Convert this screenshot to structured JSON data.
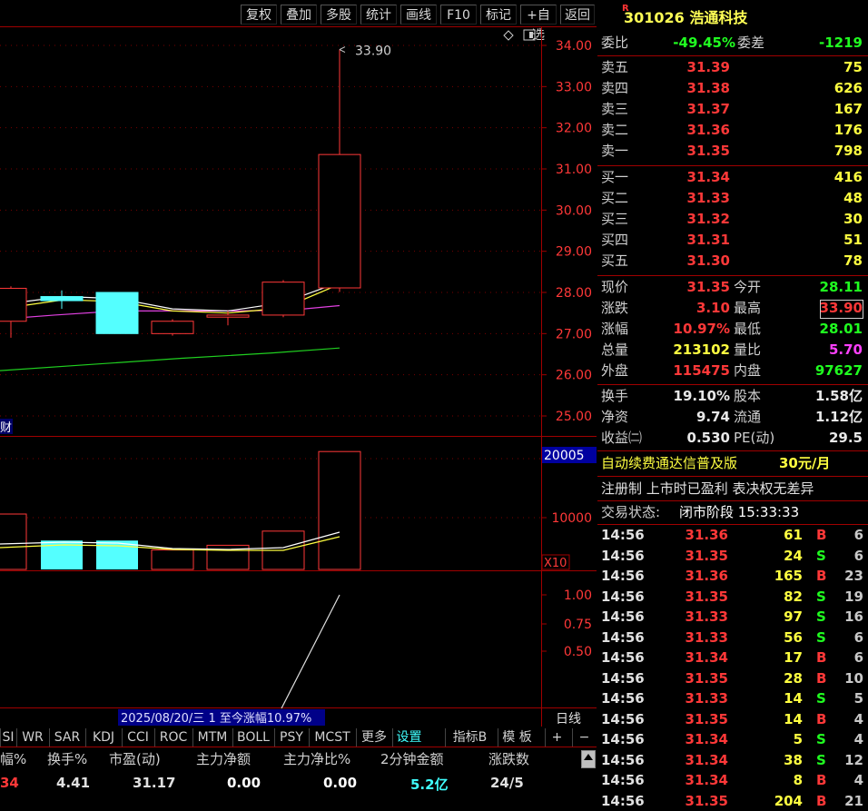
{
  "toolbar": {
    "buttons": [
      "复权",
      "叠加",
      "多股",
      "统计",
      "画线",
      "F10",
      "标记",
      "+自选",
      "返回"
    ]
  },
  "stock": {
    "badge": "R",
    "code": "301026",
    "name": "浩通科技"
  },
  "chart": {
    "price_axis": [
      "34.00",
      "33.00",
      "32.00",
      "31.00",
      "30.00",
      "29.00",
      "28.00",
      "27.00",
      "26.00",
      "25.00"
    ],
    "high_label": "33.90",
    "fin_label": "财",
    "vol_axis": [
      "20005",
      "10000"
    ],
    "vol_badge": "20005",
    "vol_x10": "X10",
    "ind_axis": [
      "1.00",
      "0.75",
      "0.50"
    ],
    "range_text": "2025/08/20/三 1 至今涨幅10.97%",
    "period": "日线"
  },
  "chart_data": {
    "type": "candlestick",
    "title": "",
    "ylim": [
      24.5,
      34.3
    ],
    "candles": [
      {
        "open": 27.3,
        "close": 28.1,
        "high": 28.15,
        "low": 26.9,
        "color": "red"
      },
      {
        "open": 27.9,
        "close": 27.8,
        "high": 28.05,
        "low": 27.6,
        "color": "cyan"
      },
      {
        "open": 28.0,
        "close": 27.0,
        "high": 28.0,
        "low": 27.0,
        "color": "cyan"
      },
      {
        "open": 27.0,
        "close": 27.3,
        "high": 27.35,
        "low": 26.95,
        "color": "red"
      },
      {
        "open": 27.4,
        "close": 27.45,
        "high": 27.55,
        "low": 27.2,
        "color": "red"
      },
      {
        "open": 27.45,
        "close": 28.25,
        "high": 28.3,
        "low": 27.4,
        "color": "red"
      },
      {
        "open": 28.11,
        "close": 31.35,
        "high": 33.9,
        "low": 28.01,
        "color": "red"
      }
    ],
    "volumes": [
      {
        "value": 9400,
        "color": "red"
      },
      {
        "value": 4900,
        "color": "cyan"
      },
      {
        "value": 4900,
        "color": "cyan"
      },
      {
        "value": 3300,
        "color": "red"
      },
      {
        "value": 4100,
        "color": "red"
      },
      {
        "value": 6500,
        "color": "red"
      },
      {
        "value": 20005,
        "color": "red"
      }
    ],
    "vol_ylim": [
      0,
      22500
    ],
    "ind_ylim": [
      0.25,
      1.05
    ],
    "ind_line": [
      [
        310,
        0.0
      ],
      [
        372,
        1.0
      ]
    ]
  },
  "quote": {
    "weibi_label": "委比",
    "weibi": "-49.45%",
    "weicha_label": "委差",
    "weicha": "-1219",
    "asks": [
      {
        "label": "卖五",
        "price": "31.39",
        "vol": "75"
      },
      {
        "label": "卖四",
        "price": "31.38",
        "vol": "626"
      },
      {
        "label": "卖三",
        "price": "31.37",
        "vol": "167"
      },
      {
        "label": "卖二",
        "price": "31.36",
        "vol": "176"
      },
      {
        "label": "卖一",
        "price": "31.35",
        "vol": "798"
      }
    ],
    "bids": [
      {
        "label": "买一",
        "price": "31.34",
        "vol": "416"
      },
      {
        "label": "买二",
        "price": "31.33",
        "vol": "48"
      },
      {
        "label": "买三",
        "price": "31.32",
        "vol": "30"
      },
      {
        "label": "买四",
        "price": "31.31",
        "vol": "51"
      },
      {
        "label": "买五",
        "price": "31.30",
        "vol": "78"
      }
    ],
    "stats": [
      {
        "l1": "现价",
        "v1": "31.35",
        "c1": "red",
        "l2": "今开",
        "v2": "28.11",
        "c2": "grn"
      },
      {
        "l1": "涨跌",
        "v1": "3.10",
        "c1": "red",
        "l2": "最高",
        "v2": "33.90",
        "c2": "red"
      },
      {
        "l1": "涨幅",
        "v1": "10.97%",
        "c1": "red",
        "l2": "最低",
        "v2": "28.01",
        "c2": "grn"
      },
      {
        "l1": "总量",
        "v1": "213102",
        "c1": "yel",
        "l2": "量比",
        "v2": "5.70",
        "c2": "mag"
      },
      {
        "l1": "外盘",
        "v1": "115475",
        "c1": "red",
        "l2": "内盘",
        "v2": "97627",
        "c2": "grn"
      }
    ],
    "fund": [
      {
        "l1": "换手",
        "v1": "19.10%",
        "l2": "股本",
        "v2": "1.58亿"
      },
      {
        "l1": "净资",
        "v1": "9.74",
        "l2": "流通",
        "v2": "1.12亿"
      },
      {
        "l1": "收益㈡",
        "v1": "0.530",
        "l2": "PE(动)",
        "v2": "29.5"
      }
    ],
    "promo": "自动续费通达信普及版",
    "promo_price": "30元/月",
    "tags": "注册制 上市时已盈利 表决权无差异",
    "trade_state_label": "交易状态:",
    "trade_state": "闭市阶段 15:33:33"
  },
  "ticks": [
    {
      "t": "14:56",
      "p": "31.36",
      "v": "61",
      "d": "B",
      "n": "6"
    },
    {
      "t": "14:56",
      "p": "31.35",
      "v": "24",
      "d": "S",
      "n": "6"
    },
    {
      "t": "14:56",
      "p": "31.36",
      "v": "165",
      "d": "B",
      "n": "23"
    },
    {
      "t": "14:56",
      "p": "31.35",
      "v": "82",
      "d": "S",
      "n": "19"
    },
    {
      "t": "14:56",
      "p": "31.33",
      "v": "97",
      "d": "S",
      "n": "16"
    },
    {
      "t": "14:56",
      "p": "31.33",
      "v": "56",
      "d": "S",
      "n": "6"
    },
    {
      "t": "14:56",
      "p": "31.34",
      "v": "17",
      "d": "B",
      "n": "6"
    },
    {
      "t": "14:56",
      "p": "31.35",
      "v": "28",
      "d": "B",
      "n": "10"
    },
    {
      "t": "14:56",
      "p": "31.33",
      "v": "14",
      "d": "S",
      "n": "5"
    },
    {
      "t": "14:56",
      "p": "31.35",
      "v": "14",
      "d": "B",
      "n": "4"
    },
    {
      "t": "14:56",
      "p": "31.34",
      "v": "5",
      "d": "S",
      "n": "4"
    },
    {
      "t": "14:56",
      "p": "31.34",
      "v": "38",
      "d": "S",
      "n": "12"
    },
    {
      "t": "14:56",
      "p": "31.34",
      "v": "8",
      "d": "B",
      "n": "4"
    },
    {
      "t": "14:56",
      "p": "31.35",
      "v": "204",
      "d": "B",
      "n": "21"
    }
  ],
  "ind_tabs": [
    "SI",
    "WR",
    "SAR",
    "KDJ",
    "CCI",
    "ROC",
    "MTM",
    "BOLL",
    "PSY",
    "MCST",
    "更多",
    "设置",
    "指标B",
    "模 板",
    "+",
    "−"
  ],
  "table": {
    "headers": [
      "幅%",
      "换手%",
      "市盈(动)",
      "主力净额",
      "主力净比%",
      "2分钟金额",
      "涨跌数"
    ],
    "row": [
      "34",
      "4.41",
      "31.17",
      "0.00",
      "0.00",
      "5.2亿",
      "24/5"
    ]
  }
}
